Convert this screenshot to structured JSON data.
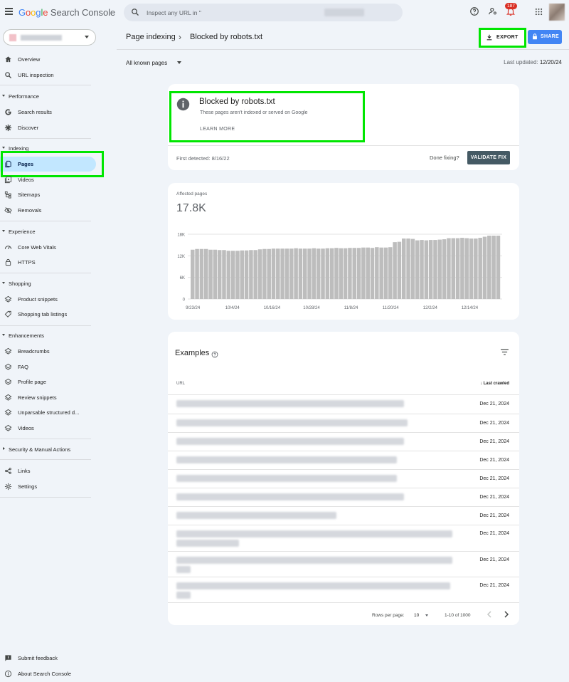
{
  "app": {
    "logo_google": "Google",
    "logo_product": "Search Console"
  },
  "search": {
    "placeholder": "Inspect any URL in \""
  },
  "notifications": {
    "count": "187"
  },
  "sidebar": {
    "top": [
      {
        "label": "Overview",
        "icon": "home-icon"
      },
      {
        "label": "URL inspection",
        "icon": "search-icon"
      }
    ],
    "sections": {
      "performance": "Performance",
      "indexing": "Indexing",
      "experience": "Experience",
      "shopping": "Shopping",
      "enhancements": "Enhancements",
      "security": "Security & Manual Actions"
    },
    "performance": [
      {
        "label": "Search results",
        "icon": "google-g-icon"
      },
      {
        "label": "Discover",
        "icon": "asterisk-icon"
      }
    ],
    "indexing": [
      {
        "label": "Pages",
        "icon": "pages-icon"
      },
      {
        "label": "Videos",
        "icon": "video-icon"
      },
      {
        "label": "Sitemaps",
        "icon": "sitemap-icon"
      },
      {
        "label": "Removals",
        "icon": "eye-off-icon"
      }
    ],
    "experience": [
      {
        "label": "Core Web Vitals",
        "icon": "speed-icon"
      },
      {
        "label": "HTTPS",
        "icon": "lock-icon"
      }
    ],
    "shopping": [
      {
        "label": "Product snippets",
        "icon": "diamond-layers-icon"
      },
      {
        "label": "Shopping tab listings",
        "icon": "tag-icon"
      }
    ],
    "enhancements": [
      {
        "label": "Breadcrumbs",
        "icon": "diamond-layers-icon"
      },
      {
        "label": "FAQ",
        "icon": "diamond-layers-icon"
      },
      {
        "label": "Profile page",
        "icon": "diamond-layers-icon"
      },
      {
        "label": "Review snippets",
        "icon": "diamond-layers-icon"
      },
      {
        "label": "Unparsable structured d...",
        "icon": "diamond-layers-icon"
      },
      {
        "label": "Videos",
        "icon": "diamond-layers-icon"
      }
    ],
    "bottom": [
      {
        "label": "Links",
        "icon": "links-icon"
      },
      {
        "label": "Settings",
        "icon": "gear-icon"
      }
    ],
    "footer": [
      {
        "label": "Submit feedback",
        "icon": "feedback-icon"
      },
      {
        "label": "About Search Console",
        "icon": "info-icon"
      }
    ]
  },
  "header": {
    "breadcrumb_parent": "Page indexing",
    "breadcrumb_current": "Blocked by robots.txt",
    "export_label": "EXPORT",
    "share_label": "SHARE"
  },
  "filter": {
    "label": "All known pages"
  },
  "last_updated": {
    "label": "Last updated:",
    "value": "12/20/24"
  },
  "issue": {
    "title": "Blocked by robots.txt",
    "subtitle": "These pages aren't indexed or served on Google",
    "learn_more": "LEARN MORE",
    "first_detected": "First detected: 8/16/22",
    "done_fixing": "Done fixing?",
    "validate_label": "VALIDATE FIX"
  },
  "affected": {
    "label": "Affected pages",
    "value": "17.8K"
  },
  "chart_data": {
    "type": "bar",
    "title": "",
    "xlabel": "",
    "ylabel": "",
    "ylim": [
      0,
      18000
    ],
    "yticks": [
      "0",
      "6K",
      "12K",
      "18K"
    ],
    "xticks": [
      "9/23/24",
      "10/4/24",
      "10/16/24",
      "10/28/24",
      "11/8/24",
      "11/20/24",
      "12/2/24",
      "12/14/24"
    ],
    "bar_color": "#bdbdbd",
    "values": [
      13700,
      13900,
      13900,
      13900,
      13700,
      13700,
      13600,
      13600,
      13400,
      13400,
      13400,
      13500,
      13500,
      13600,
      13600,
      13800,
      13900,
      13900,
      14000,
      14000,
      14000,
      14000,
      14000,
      14100,
      14000,
      14000,
      14000,
      14100,
      14000,
      14000,
      14100,
      14100,
      14200,
      14100,
      14100,
      14200,
      14200,
      14200,
      14300,
      14300,
      14200,
      14400,
      14300,
      14300,
      14400,
      15800,
      15900,
      16800,
      16800,
      16700,
      16300,
      16400,
      16300,
      16400,
      16400,
      16500,
      16600,
      16900,
      16900,
      16900,
      17000,
      16900,
      16800,
      16800,
      17000,
      17300,
      17600,
      17600,
      17600
    ]
  },
  "examples": {
    "title": "Examples",
    "col_url": "URL",
    "col_last_crawled": "Last crawled",
    "rows": [
      {
        "date": "Dec 21, 2024"
      },
      {
        "date": "Dec 21, 2024"
      },
      {
        "date": "Dec 21, 2024"
      },
      {
        "date": "Dec 21, 2024"
      },
      {
        "date": "Dec 21, 2024"
      },
      {
        "date": "Dec 21, 2024"
      },
      {
        "date": "Dec 21, 2024"
      },
      {
        "date": "Dec 21, 2024"
      },
      {
        "date": "Dec 21, 2024"
      },
      {
        "date": "Dec 21, 2024"
      }
    ],
    "rows_per_page_label": "Rows per page:",
    "rows_per_page": "10",
    "range": "1-10 of 1000"
  }
}
